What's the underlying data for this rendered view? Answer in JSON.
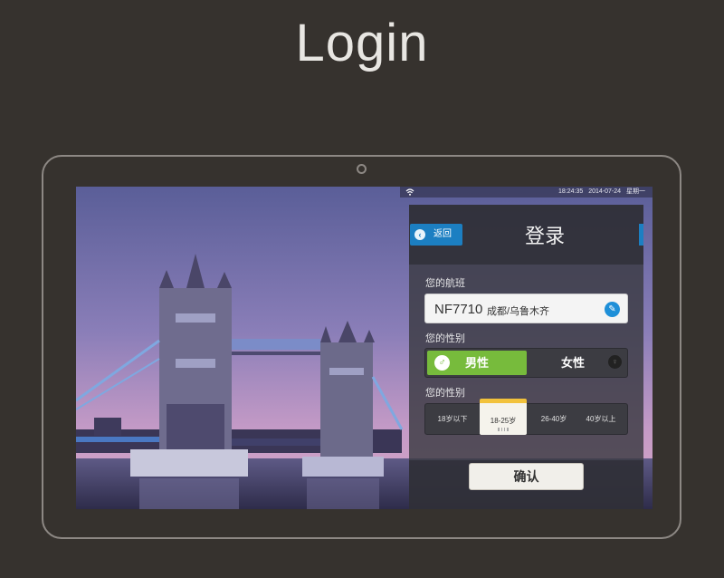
{
  "page": {
    "title": "Login"
  },
  "status_bar": {
    "time": "18:24:35",
    "date": "2014-07-24",
    "weekday": "星期一"
  },
  "header": {
    "back_label": "返回",
    "title": "登录"
  },
  "flight": {
    "label": "您的航班",
    "number": "NF7710",
    "route": "成都/乌鲁木齐"
  },
  "gender": {
    "label": "您的性别",
    "male": "男性",
    "female": "女性",
    "selected": "男性"
  },
  "age": {
    "label": "您的性别",
    "options": [
      "18岁以下",
      "18-25岁",
      "26-40岁",
      "40岁以上"
    ],
    "selected": "18-25岁"
  },
  "actions": {
    "confirm_label": "确认"
  },
  "icons": {
    "back": "chevron-left-icon",
    "edit": "pencil-icon",
    "male": "male-symbol-icon",
    "female": "female-symbol-icon",
    "wifi": "wifi-icon",
    "camera": "camera-icon"
  },
  "colors": {
    "accent_blue": "#1c7fc2",
    "selected_green": "#77bb3c",
    "selected_age_marker": "#f2c23c"
  }
}
